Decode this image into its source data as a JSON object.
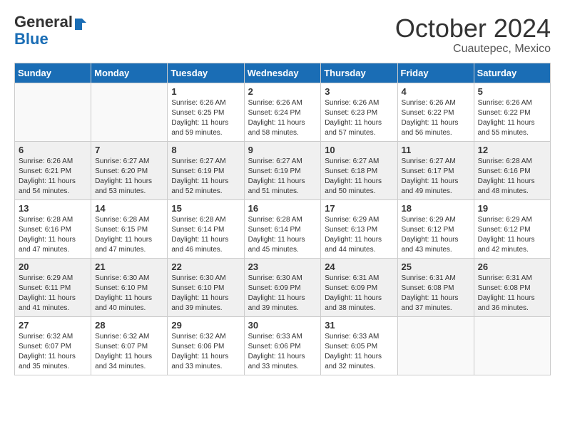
{
  "header": {
    "logo_general": "General",
    "logo_blue": "Blue",
    "month": "October 2024",
    "location": "Cuautepec, Mexico"
  },
  "weekdays": [
    "Sunday",
    "Monday",
    "Tuesday",
    "Wednesday",
    "Thursday",
    "Friday",
    "Saturday"
  ],
  "weeks": [
    [
      {
        "day": "",
        "info": ""
      },
      {
        "day": "",
        "info": ""
      },
      {
        "day": "1",
        "info": "Sunrise: 6:26 AM\nSunset: 6:25 PM\nDaylight: 11 hours\nand 59 minutes."
      },
      {
        "day": "2",
        "info": "Sunrise: 6:26 AM\nSunset: 6:24 PM\nDaylight: 11 hours\nand 58 minutes."
      },
      {
        "day": "3",
        "info": "Sunrise: 6:26 AM\nSunset: 6:23 PM\nDaylight: 11 hours\nand 57 minutes."
      },
      {
        "day": "4",
        "info": "Sunrise: 6:26 AM\nSunset: 6:22 PM\nDaylight: 11 hours\nand 56 minutes."
      },
      {
        "day": "5",
        "info": "Sunrise: 6:26 AM\nSunset: 6:22 PM\nDaylight: 11 hours\nand 55 minutes."
      }
    ],
    [
      {
        "day": "6",
        "info": "Sunrise: 6:26 AM\nSunset: 6:21 PM\nDaylight: 11 hours\nand 54 minutes."
      },
      {
        "day": "7",
        "info": "Sunrise: 6:27 AM\nSunset: 6:20 PM\nDaylight: 11 hours\nand 53 minutes."
      },
      {
        "day": "8",
        "info": "Sunrise: 6:27 AM\nSunset: 6:19 PM\nDaylight: 11 hours\nand 52 minutes."
      },
      {
        "day": "9",
        "info": "Sunrise: 6:27 AM\nSunset: 6:19 PM\nDaylight: 11 hours\nand 51 minutes."
      },
      {
        "day": "10",
        "info": "Sunrise: 6:27 AM\nSunset: 6:18 PM\nDaylight: 11 hours\nand 50 minutes."
      },
      {
        "day": "11",
        "info": "Sunrise: 6:27 AM\nSunset: 6:17 PM\nDaylight: 11 hours\nand 49 minutes."
      },
      {
        "day": "12",
        "info": "Sunrise: 6:28 AM\nSunset: 6:16 PM\nDaylight: 11 hours\nand 48 minutes."
      }
    ],
    [
      {
        "day": "13",
        "info": "Sunrise: 6:28 AM\nSunset: 6:16 PM\nDaylight: 11 hours\nand 47 minutes."
      },
      {
        "day": "14",
        "info": "Sunrise: 6:28 AM\nSunset: 6:15 PM\nDaylight: 11 hours\nand 47 minutes."
      },
      {
        "day": "15",
        "info": "Sunrise: 6:28 AM\nSunset: 6:14 PM\nDaylight: 11 hours\nand 46 minutes."
      },
      {
        "day": "16",
        "info": "Sunrise: 6:28 AM\nSunset: 6:14 PM\nDaylight: 11 hours\nand 45 minutes."
      },
      {
        "day": "17",
        "info": "Sunrise: 6:29 AM\nSunset: 6:13 PM\nDaylight: 11 hours\nand 44 minutes."
      },
      {
        "day": "18",
        "info": "Sunrise: 6:29 AM\nSunset: 6:12 PM\nDaylight: 11 hours\nand 43 minutes."
      },
      {
        "day": "19",
        "info": "Sunrise: 6:29 AM\nSunset: 6:12 PM\nDaylight: 11 hours\nand 42 minutes."
      }
    ],
    [
      {
        "day": "20",
        "info": "Sunrise: 6:29 AM\nSunset: 6:11 PM\nDaylight: 11 hours\nand 41 minutes."
      },
      {
        "day": "21",
        "info": "Sunrise: 6:30 AM\nSunset: 6:10 PM\nDaylight: 11 hours\nand 40 minutes."
      },
      {
        "day": "22",
        "info": "Sunrise: 6:30 AM\nSunset: 6:10 PM\nDaylight: 11 hours\nand 39 minutes."
      },
      {
        "day": "23",
        "info": "Sunrise: 6:30 AM\nSunset: 6:09 PM\nDaylight: 11 hours\nand 39 minutes."
      },
      {
        "day": "24",
        "info": "Sunrise: 6:31 AM\nSunset: 6:09 PM\nDaylight: 11 hours\nand 38 minutes."
      },
      {
        "day": "25",
        "info": "Sunrise: 6:31 AM\nSunset: 6:08 PM\nDaylight: 11 hours\nand 37 minutes."
      },
      {
        "day": "26",
        "info": "Sunrise: 6:31 AM\nSunset: 6:08 PM\nDaylight: 11 hours\nand 36 minutes."
      }
    ],
    [
      {
        "day": "27",
        "info": "Sunrise: 6:32 AM\nSunset: 6:07 PM\nDaylight: 11 hours\nand 35 minutes."
      },
      {
        "day": "28",
        "info": "Sunrise: 6:32 AM\nSunset: 6:07 PM\nDaylight: 11 hours\nand 34 minutes."
      },
      {
        "day": "29",
        "info": "Sunrise: 6:32 AM\nSunset: 6:06 PM\nDaylight: 11 hours\nand 33 minutes."
      },
      {
        "day": "30",
        "info": "Sunrise: 6:33 AM\nSunset: 6:06 PM\nDaylight: 11 hours\nand 33 minutes."
      },
      {
        "day": "31",
        "info": "Sunrise: 6:33 AM\nSunset: 6:05 PM\nDaylight: 11 hours\nand 32 minutes."
      },
      {
        "day": "",
        "info": ""
      },
      {
        "day": "",
        "info": ""
      }
    ]
  ]
}
